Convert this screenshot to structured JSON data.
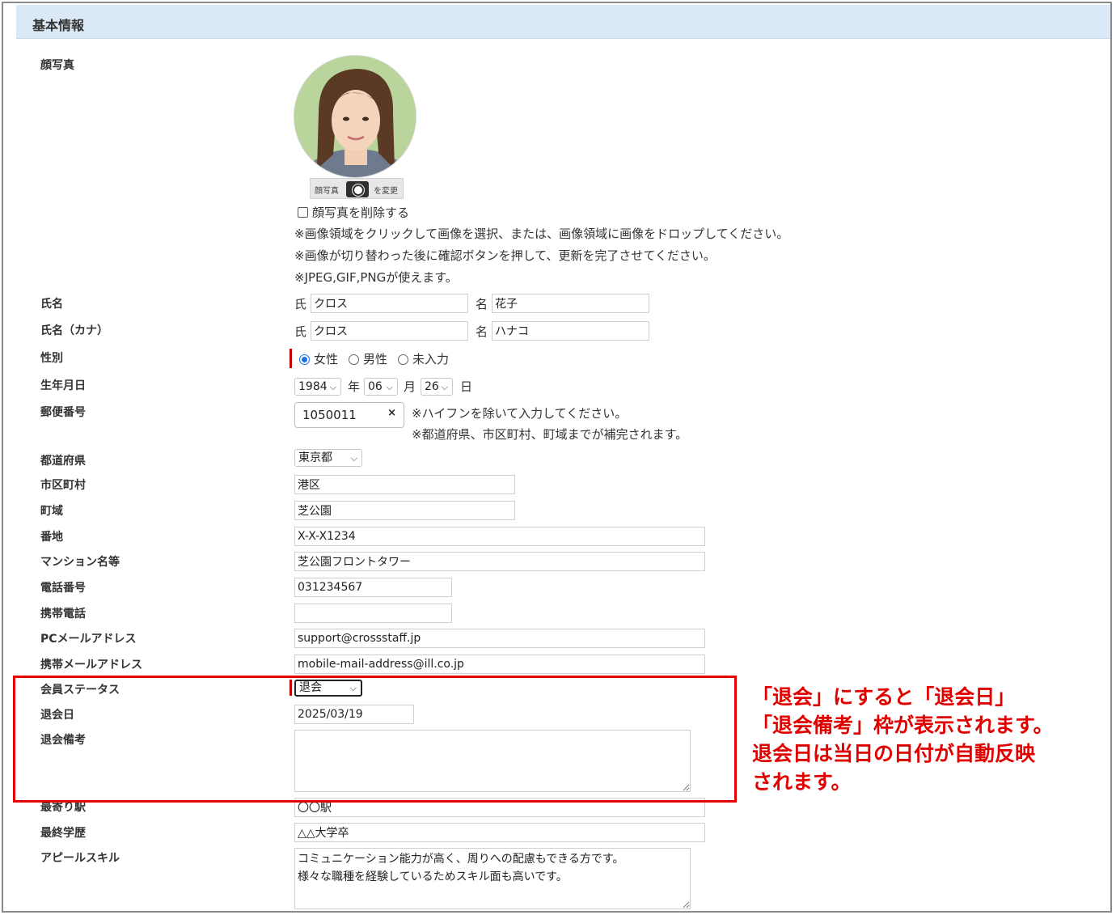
{
  "section_title": "基本情報",
  "labels": {
    "photo": "顔写真",
    "name": "氏名",
    "name_kana": "氏名（カナ）",
    "gender": "性別",
    "birthdate": "生年月日",
    "postal_code": "郵便番号",
    "prefecture": "都道府県",
    "city": "市区町村",
    "town": "町域",
    "address_number": "番地",
    "building": "マンション名等",
    "phone": "電話番号",
    "mobile": "携帯電話",
    "pc_email": "PCメールアドレス",
    "mobile_email": "携帯メールアドレス",
    "member_status": "会員ステータス",
    "withdrawal_date": "退会日",
    "withdrawal_note": "退会備考",
    "nearest_station": "最寄り駅",
    "education": "最終学歴",
    "appeal_skill": "アピールスキル"
  },
  "photo": {
    "change_button_left": "顔写真",
    "change_button_right": "を変更",
    "camera_icon": "camera-icon",
    "delete_checkbox_label": "顔写真を削除する",
    "delete_checked": false,
    "notes": [
      "※画像領域をクリックして画像を選択、または、画像領域に画像をドロップしてください。",
      "※画像が切り替わった後に確認ボタンを押して、更新を完了させてください。",
      "※JPEG,GIF,PNGが使えます。"
    ]
  },
  "name": {
    "last_prefix": "氏",
    "first_prefix": "名",
    "last": "クロス",
    "first": "花子"
  },
  "name_kana": {
    "last_prefix": "氏",
    "first_prefix": "名",
    "last": "クロス",
    "first": "ハナコ"
  },
  "gender": {
    "options": [
      "女性",
      "男性",
      "未入力"
    ],
    "selected": "女性"
  },
  "birthdate": {
    "year": "1984",
    "year_unit": "年",
    "month": "06",
    "month_unit": "月",
    "day": "26",
    "day_unit": "日"
  },
  "postal": {
    "value": "1050011",
    "clear_symbol": "×",
    "notes": [
      "※ハイフンを除いて入力してください。",
      "※都道府県、市区町村、町域までが補完されます。"
    ]
  },
  "prefecture": "東京都",
  "city": "港区",
  "town": "芝公園",
  "address_number": "X-X-X1234",
  "building": "芝公園フロントタワー",
  "phone": "031234567",
  "mobile": "",
  "pc_email": "support@crossstaff.jp",
  "mobile_email": "mobile-mail-address@ill.co.jp",
  "member_status": "退会",
  "withdrawal_date": "2025/03/19",
  "withdrawal_note": "",
  "nearest_station": "〇〇駅",
  "education": "△△大学卒",
  "appeal_skill": "コミュニケーション能力が高く、周りへの配慮もできる方です。\n様々な職種を経験しているためスキル面も高いです。",
  "annotation": {
    "lines": [
      "「退会」にすると「退会日」",
      "「退会備考」枠が表示されます。",
      "退会日は当日の日付が自動反映",
      "されます。"
    ],
    "color": "#e00000"
  }
}
